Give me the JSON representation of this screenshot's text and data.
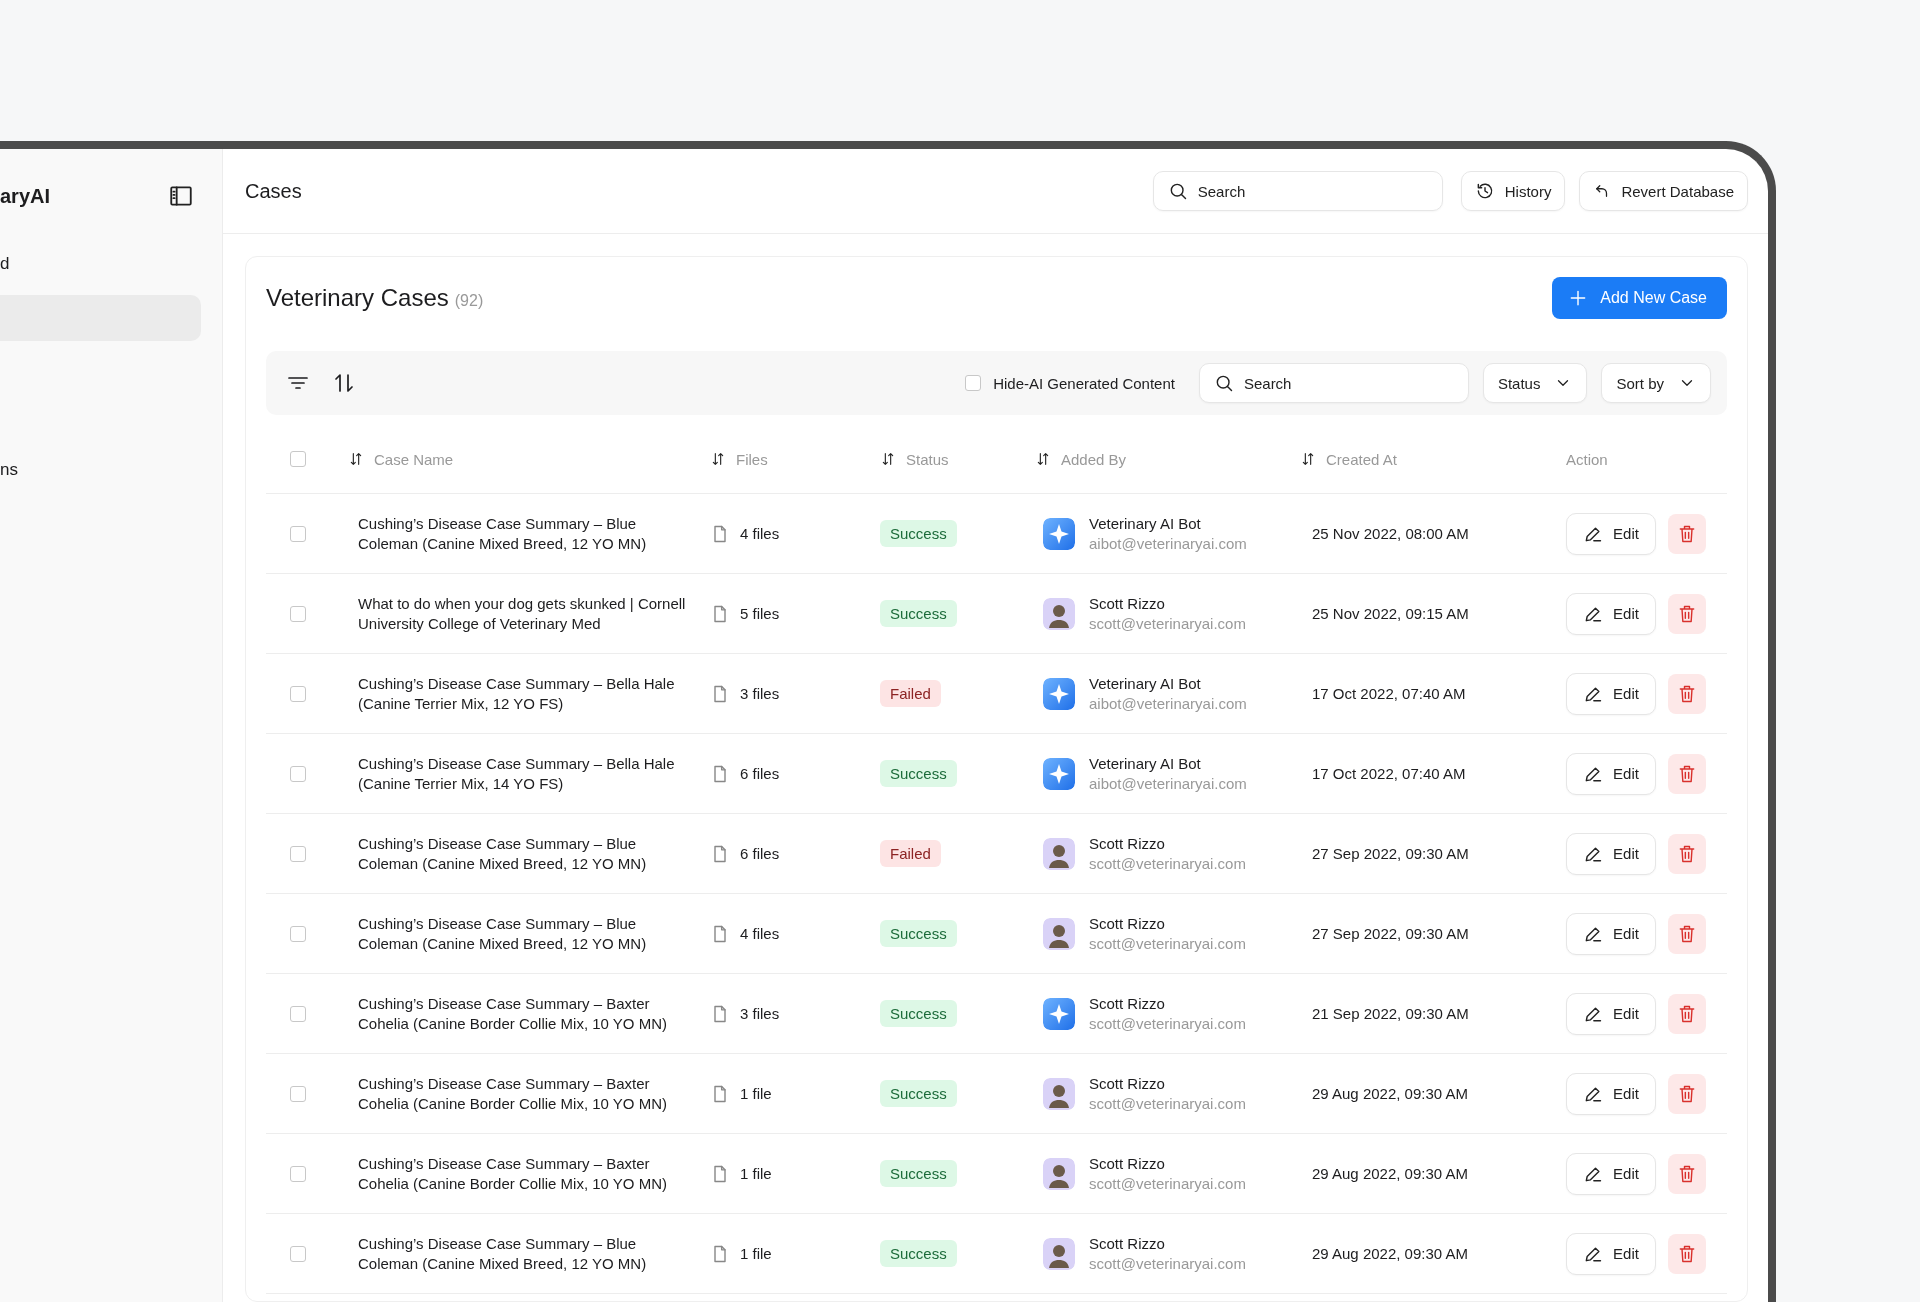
{
  "sidebar": {
    "logo": "aryAI",
    "items": [
      {
        "label": "d",
        "selected": false
      },
      {
        "selected": true
      }
    ],
    "bottom_items": [
      {
        "label": "ns",
        "selected": false
      }
    ]
  },
  "header": {
    "title": "Cases",
    "search": {
      "placeholder": "Search"
    },
    "buttons": [
      {
        "label": "History",
        "kind": "history"
      },
      {
        "label": "Revert Database",
        "kind": "revert"
      }
    ]
  },
  "card": {
    "title": "Veterinary Cases",
    "count": "(92)",
    "add_button": "Add New Case"
  },
  "toolbar": {
    "hide_ai": {
      "label": "Hide-AI Generated Content",
      "checked": false
    },
    "search": {
      "placeholder": "Search"
    },
    "dropdowns": [
      "Status",
      "Sort by"
    ]
  },
  "table": {
    "all_checked": false,
    "columns": [
      {
        "label": "Case Name",
        "sortable": true
      },
      {
        "label": "Files",
        "sortable": true
      },
      {
        "label": "Status",
        "sortable": true
      },
      {
        "label": "Added By",
        "sortable": true
      },
      {
        "label": "Created At",
        "sortable": true
      },
      {
        "label": "Action",
        "sortable": false
      }
    ],
    "rows": [
      {
        "checked": false,
        "name": "Cushing’s Disease Case Summary – Blue Coleman (Canine Mixed Breed, 12 YO MN)",
        "files": "4 files",
        "status": {
          "label": "Success",
          "kind": "success"
        },
        "added_by": {
          "name": "Veterinary AI Bot",
          "email": "aibot@veterinaryai.com",
          "kind": "bot"
        },
        "created_at": "25 Nov 2022, 08:00 AM",
        "edit": "Edit"
      },
      {
        "checked": false,
        "name": "What to do when your dog gets skunked | Cornell University College of Veterinary Med",
        "files": "5 files",
        "status": {
          "label": "Success",
          "kind": "success"
        },
        "added_by": {
          "name": "Scott Rizzo",
          "email": "scott@veterinaryai.com",
          "kind": "person"
        },
        "created_at": "25 Nov 2022, 09:15 AM",
        "edit": "Edit"
      },
      {
        "checked": false,
        "name": "Cushing’s Disease Case Summary – Bella Hale (Canine Terrier Mix, 12 YO FS)",
        "files": "3 files",
        "status": {
          "label": "Failed",
          "kind": "failed"
        },
        "added_by": {
          "name": "Veterinary AI Bot",
          "email": "aibot@veterinaryai.com",
          "kind": "bot"
        },
        "created_at": "17 Oct 2022, 07:40 AM",
        "edit": "Edit"
      },
      {
        "checked": false,
        "name": "Cushing’s Disease Case Summary – Bella Hale (Canine Terrier Mix, 14 YO FS)",
        "files": "6 files",
        "status": {
          "label": "Success",
          "kind": "success"
        },
        "added_by": {
          "name": "Veterinary AI Bot",
          "email": "aibot@veterinaryai.com",
          "kind": "bot"
        },
        "created_at": "17 Oct 2022, 07:40 AM",
        "edit": "Edit"
      },
      {
        "checked": false,
        "name": "Cushing’s Disease Case Summary – Blue Coleman (Canine Mixed Breed, 12 YO MN)",
        "files": "6 files",
        "status": {
          "label": "Failed",
          "kind": "failed"
        },
        "added_by": {
          "name": "Scott Rizzo",
          "email": "scott@veterinaryai.com",
          "kind": "person"
        },
        "created_at": "27 Sep 2022, 09:30 AM",
        "edit": "Edit"
      },
      {
        "checked": false,
        "name": "Cushing’s Disease Case Summary – Blue Coleman (Canine Mixed Breed, 12 YO MN)",
        "files": "4 files",
        "status": {
          "label": "Success",
          "kind": "success"
        },
        "added_by": {
          "name": "Scott Rizzo",
          "email": "scott@veterinaryai.com",
          "kind": "person"
        },
        "created_at": "27 Sep 2022, 09:30 AM",
        "edit": "Edit"
      },
      {
        "checked": false,
        "name": "Cushing’s Disease Case Summary – Baxter Cohelia (Canine Border Collie Mix, 10 YO MN)",
        "files": "3 files",
        "status": {
          "label": "Success",
          "kind": "success"
        },
        "added_by": {
          "name": "Scott Rizzo",
          "email": "scott@veterinaryai.com",
          "kind": "bot"
        },
        "created_at": "21 Sep 2022, 09:30 AM",
        "edit": "Edit"
      },
      {
        "checked": false,
        "name": "Cushing’s Disease Case Summary – Baxter Cohelia (Canine Border Collie Mix, 10 YO MN)",
        "files": "1 file",
        "status": {
          "label": "Success",
          "kind": "success"
        },
        "added_by": {
          "name": "Scott Rizzo",
          "email": "scott@veterinaryai.com",
          "kind": "person"
        },
        "created_at": "29 Aug 2022, 09:30 AM",
        "edit": "Edit"
      },
      {
        "checked": false,
        "name": "Cushing’s Disease Case Summary – Baxter Cohelia (Canine Border Collie Mix, 10 YO MN)",
        "files": "1 file",
        "status": {
          "label": "Success",
          "kind": "success"
        },
        "added_by": {
          "name": "Scott Rizzo",
          "email": "scott@veterinaryai.com",
          "kind": "person"
        },
        "created_at": "29 Aug 2022, 09:30 AM",
        "edit": "Edit"
      },
      {
        "checked": false,
        "name": "Cushing’s Disease Case Summary – Blue Coleman (Canine Mixed Breed, 12 YO MN)",
        "files": "1 file",
        "status": {
          "label": "Success",
          "kind": "success"
        },
        "added_by": {
          "name": "Scott Rizzo",
          "email": "scott@veterinaryai.com",
          "kind": "person"
        },
        "created_at": "29 Aug 2022, 09:30 AM",
        "edit": "Edit"
      }
    ]
  }
}
